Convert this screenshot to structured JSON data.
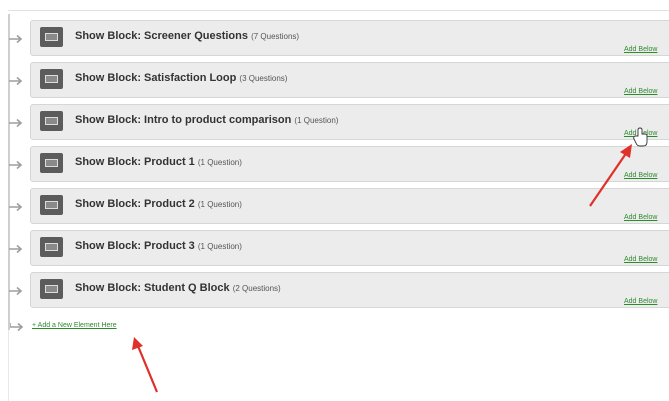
{
  "blocks": [
    {
      "label": "Show Block: Screener Questions",
      "count": "(7 Questions)",
      "add_below": "Add Below"
    },
    {
      "label": "Show Block: Satisfaction Loop",
      "count": "(3 Questions)",
      "add_below": "Add Below"
    },
    {
      "label": "Show Block: Intro to product comparison",
      "count": "(1 Question)",
      "add_below": "Add Below"
    },
    {
      "label": "Show Block: Product 1",
      "count": "(1 Question)",
      "add_below": "Add Below"
    },
    {
      "label": "Show Block: Product 2",
      "count": "(1 Question)",
      "add_below": "Add Below"
    },
    {
      "label": "Show Block: Product 3",
      "count": "(1 Question)",
      "add_below": "Add Below"
    },
    {
      "label": "Show Block: Student Q Block",
      "count": "(2 Questions)",
      "add_below": "Add Below"
    }
  ],
  "add_element_label": "+ Add a New Element Here",
  "colors": {
    "link_green": "#2f8a2f",
    "annotation_red": "#e0302a",
    "row_background": "#ececec"
  },
  "icons": {
    "block": "block-icon",
    "connector": "connector-arrow-icon",
    "cursor": "hand-cursor-icon",
    "annotation": "annotation-arrow-icon"
  }
}
